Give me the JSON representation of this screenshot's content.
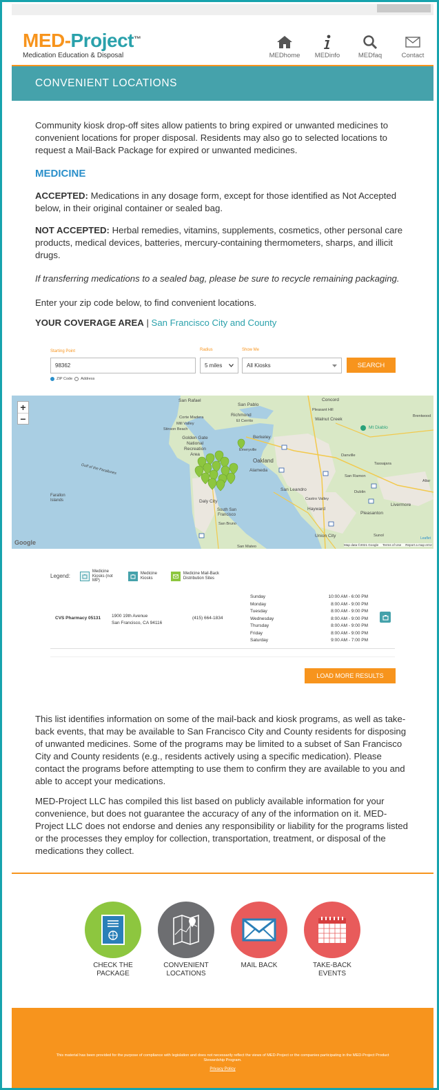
{
  "header": {
    "logo_main": "MED-",
    "logo_accent": "Project",
    "logo_tm": "™",
    "logo_tagline": "Medication Education & Disposal",
    "nav": [
      {
        "label": "MEDhome",
        "icon": "home-icon"
      },
      {
        "label": "MEDinfo",
        "icon": "info-icon"
      },
      {
        "label": "MEDfaq",
        "icon": "search-icon"
      },
      {
        "label": "Contact",
        "icon": "envelope-icon"
      }
    ]
  },
  "banner": {
    "title": "CONVENIENT LOCATIONS"
  },
  "intro": "Community kiosk drop-off sites allow patients to bring expired or unwanted medicines to convenient locations for proper disposal. Residents may also go to selected locations to request a Mail-Back Package for expired or unwanted medicines.",
  "medicine": {
    "title": "MEDICINE",
    "accepted_label": "ACCEPTED:",
    "accepted_text": " Medications in any dosage form, except for those identified as Not Accepted below, in their original container or sealed bag.",
    "not_accepted_label": "NOT ACCEPTED:",
    "not_accepted_text": " Herbal remedies, vitamins, supplements, cosmetics, other personal care products, medical devices, batteries, mercury-containing thermometers, sharps, and illicit drugs.",
    "note": "If transferring medications to a sealed bag, please be sure to recycle remaining packaging.",
    "zip_prompt": "Enter your zip code below, to find convenient locations."
  },
  "coverage": {
    "label": "YOUR COVERAGE AREA",
    "sep": " | ",
    "area": "San Francisco City and County"
  },
  "search": {
    "starting_label": "Starting Point",
    "starting_value": "98362",
    "radius_label": "Radius",
    "radius_value": "5 miles",
    "show_label": "Show Me",
    "show_value": "All Kiosks",
    "button": "SEARCH",
    "opt_zip": "ZIP Code",
    "opt_address": "Address"
  },
  "map": {
    "zoom_in": "+",
    "zoom_out": "−",
    "labels": [
      "San Rafael",
      "San Pablo",
      "Concord",
      "Pleasant Hill",
      "Richmond",
      "Corte Madera",
      "Mill Valley",
      "El Cerrito",
      "Walnut Creek",
      "Mt Diablo",
      "Brentwood",
      "Stinson Beach",
      "Berkeley",
      "Golden Gate National Recreation Area",
      "Emeryville",
      "Danville",
      "Oakland",
      "Alameda",
      "Tassajara",
      "Gulf of the Farallones",
      "San Ramon",
      "Farallon Islands",
      "San Leandro",
      "Dublin",
      "Altar",
      "Daly City",
      "Castro Valley",
      "Hayward",
      "Pleasanton",
      "Livermore",
      "South San Francisco",
      "San Bruno",
      "Union City",
      "Sunol",
      "San Mateo"
    ],
    "google": "Google",
    "leaflet": "Leaflet",
    "attribution": [
      "Map data ©2021 Google",
      "Terms of Use",
      "Report a map error"
    ]
  },
  "legend": {
    "label": "Legend:",
    "items": [
      {
        "text": "Medicine Kiosks (not MP)",
        "color": "#ffffff",
        "border": "#45a2ab"
      },
      {
        "text": "Medicine Kiosks",
        "color": "#45a2ab",
        "border": "#45a2ab"
      },
      {
        "text": "Medicine Mail-Back Distribution Sites",
        "color": "#8dc63f",
        "border": "#8dc63f"
      }
    ]
  },
  "result": {
    "name": "CVS Pharmacy 05131",
    "address_line1": "1900 19th Avenue",
    "address_line2": "San Francisco, CA 94116",
    "phone": "(415) 664-1834",
    "days": [
      "Sunday",
      "Monday",
      "Tuesday",
      "Wednesday",
      "Thursday",
      "Friday",
      "Saturday"
    ],
    "times": [
      "10:00 AM - 6:00 PM",
      "8:00 AM - 9:00 PM",
      "8:00 AM - 9:00 PM",
      "8:00 AM - 9:00 PM",
      "8:00 AM - 9:00 PM",
      "8:00 AM - 9:00 PM",
      "9:00 AM - 7:00 PM"
    ]
  },
  "load_more": "LOAD MORE RESULTS",
  "disclaimer1": "This list identifies information on some of the mail-back and kiosk programs, as well as take-back events, that may be available to San Francisco City and County residents for disposing of unwanted medicines. Some of the programs may be limited to a subset of San Francisco City and County residents (e.g., residents actively using a specific medication). Please contact the programs before attempting to use them to confirm they are available to you and able to accept your medications.",
  "disclaimer2": "MED-Project LLC has compiled this list based on publicly available information for your convenience, but does not guarantee the accuracy of any of the information on it. MED-Project LLC does not endorse and denies any responsibility or liability for the programs listed or the processes they employ for collection, transportation, treatment, or disposal of the medications they collect.",
  "tiles": [
    {
      "label": "CHECK THE PACKAGE",
      "color": "#8dc63f",
      "icon": "package-icon"
    },
    {
      "label": "CONVENIENT LOCATIONS",
      "color": "#6d6e71",
      "icon": "map-icon"
    },
    {
      "label": "MAIL BACK",
      "color": "#e85b5b",
      "icon": "envelope-icon"
    },
    {
      "label": "TAKE-BACK EVENTS",
      "color": "#e85b5b",
      "icon": "calendar-icon"
    }
  ],
  "footer": {
    "disclaimer": "This material has been provided for the purpose of compliance with legislation and does not necessarily reflect the views of MED-Project or the companies participating in the MED-Project Product Stewardship Program.",
    "privacy": "Privacy Policy"
  }
}
